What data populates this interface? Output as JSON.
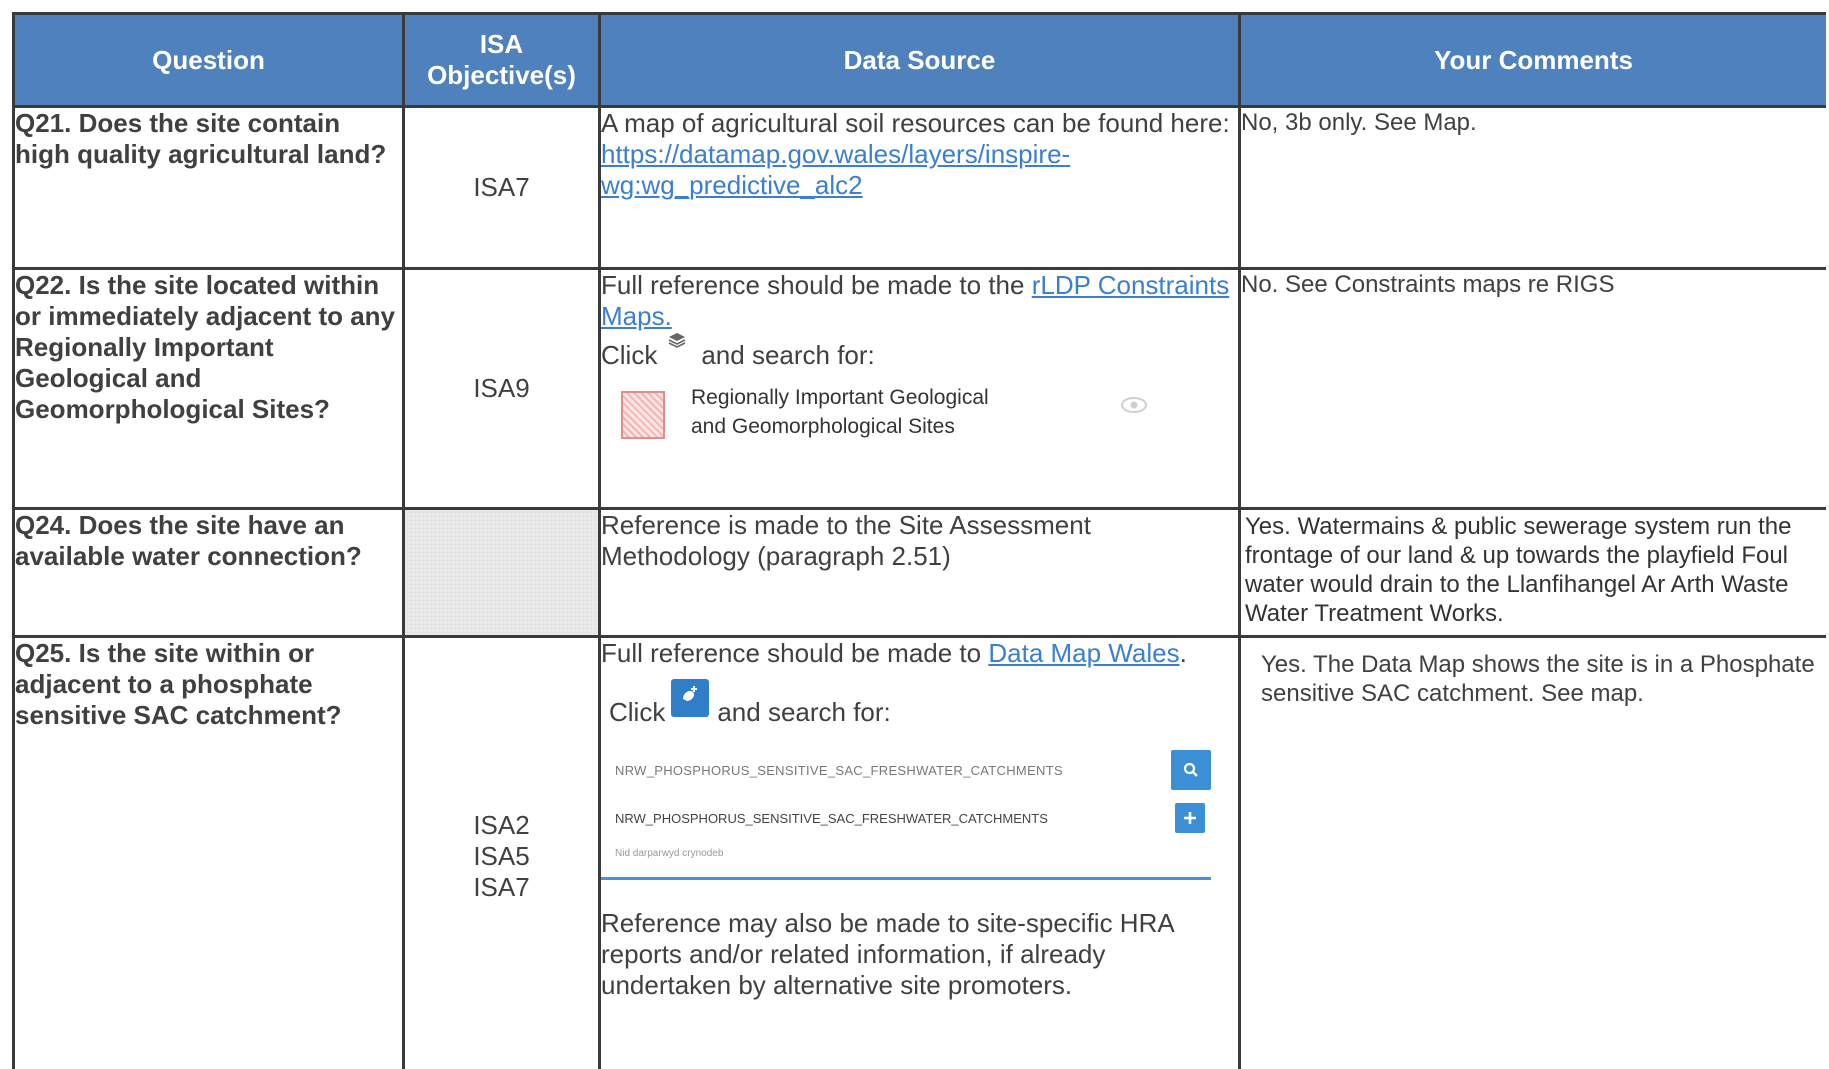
{
  "header": {
    "question": "Question",
    "isa": "ISA Objective(s)",
    "data_source": "Data Source",
    "comments": "Your Comments"
  },
  "rows": [
    {
      "question": "Q21. Does the site contain high quality agricultural land?",
      "isa": "ISA7",
      "ds_text": "A map of agricultural soil resources can be found here:",
      "ds_link": "https://datamap.gov.wales/layers/inspire-wg:wg_predictive_alc2",
      "comment": "No, 3b only. See Map."
    },
    {
      "question": "Q22. Is the site located within or immediately adjacent to any Regionally Important Geological and Geomorphological Sites?",
      "isa": "ISA9",
      "ds_text": "Full reference should be made to the",
      "ds_link": "rLDP Constraints Maps.",
      "click_label": "Click",
      "click_after": "and search for:",
      "legend_label": "Regionally Important Geological and Geomorphological Sites",
      "comment": "No. See Constraints maps re RIGS"
    },
    {
      "question": "Q24. Does the site have an available water connection?",
      "isa": "",
      "ds_text": "Reference is made to the Site Assessment Methodology (paragraph 2.51)",
      "comment": "Yes. Watermains & public sewerage system run the frontage of our land & up towards the playfield Foul water would drain to the Llanfihangel Ar Arth Waste Water Treatment Works."
    },
    {
      "question": "Q25. Is the site within or adjacent to a phosphate sensitive SAC catchment?",
      "isa_lines": [
        "ISA2",
        "ISA5",
        "ISA7"
      ],
      "ds_text": "Full reference should be made to",
      "ds_link": "Data Map Wales",
      "ds_after": ".",
      "click_label": "Click",
      "click_after": "and search for:",
      "search_query": "NRW_PHOSPHORUS_SENSITIVE_SAC_FRESHWATER_CATCHMENTS",
      "result_title": "NRW_PHOSPHORUS_SENSITIVE_SAC_FRESHWATER_CATCHMENTS",
      "result_sub": "Nid darparwyd crynodeb",
      "ds_para2": "Reference may also be made to site-specific HRA reports and/or related information, if already undertaken by alternative site promoters.",
      "comment": "Yes.  The Data Map shows the site is in a Phosphate sensitive SAC catchment. See map."
    }
  ],
  "icons": {
    "layers": "layers-icon",
    "eye": "eye-icon",
    "add_layer": "add-layer-icon",
    "search": "search-icon",
    "plus": "plus-icon"
  },
  "colors": {
    "header_bg": "#4f81bd",
    "link": "#3a7fd0",
    "button": "#3b8fd6"
  }
}
